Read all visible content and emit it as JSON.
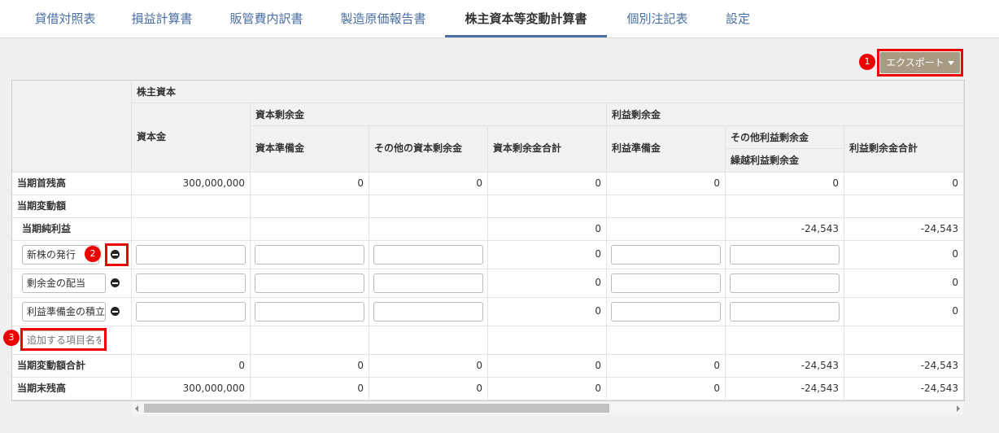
{
  "tabs": [
    "貸借対照表",
    "損益計算書",
    "販管費内訳書",
    "製造原価報告書",
    "株主資本等変動計算書",
    "個別注記表",
    "設定"
  ],
  "export_label": "エクスポート",
  "headers": {
    "shareholders_equity": "株主資本",
    "capital_stock": "資本金",
    "capital_surplus": "資本剰余金",
    "capital_reserve": "資本準備金",
    "other_capital_surplus": "その他の資本剰余金",
    "capital_surplus_total": "資本剰余金合計",
    "retained_earnings": "利益剰余金",
    "legal_reserve": "利益準備金",
    "other_retained_earnings": "その他利益剰余金",
    "retained_earnings_brought_forward": "繰越利益剰余金",
    "retained_earnings_total": "利益剰余金合計"
  },
  "rows": {
    "opening": {
      "label": "当期首残高",
      "values": [
        "300,000,000",
        "0",
        "0",
        "0",
        "0",
        "0",
        "0"
      ]
    },
    "changes": {
      "label": "当期変動額"
    },
    "net_income": {
      "label": "当期純利益",
      "values": [
        "",
        "",
        "",
        "0",
        "",
        "-24,543",
        "-24,543"
      ]
    },
    "new_shares": {
      "label": "新株の発行",
      "capital_total": "0",
      "retained_total": "0"
    },
    "dividend": {
      "label": "剰余金の配当",
      "capital_total": "0",
      "retained_total": "0"
    },
    "legal_reserve": {
      "label": "利益準備金の積立",
      "capital_total": "0",
      "retained_total": "0"
    },
    "add_item": {
      "placeholder": "追加する項目名を"
    },
    "change_total": {
      "label": "当期変動額合計",
      "values": [
        "0",
        "0",
        "0",
        "0",
        "0",
        "-24,543",
        "-24,543"
      ]
    },
    "closing": {
      "label": "当期末残高",
      "values": [
        "300,000,000",
        "0",
        "0",
        "0",
        "0",
        "-24,543",
        "-24,543"
      ]
    }
  },
  "annotations": [
    "1",
    "2",
    "3"
  ],
  "colors": {
    "accent": "#4a6fa5",
    "export": "#a89b84",
    "highlight": "#ee0000"
  }
}
